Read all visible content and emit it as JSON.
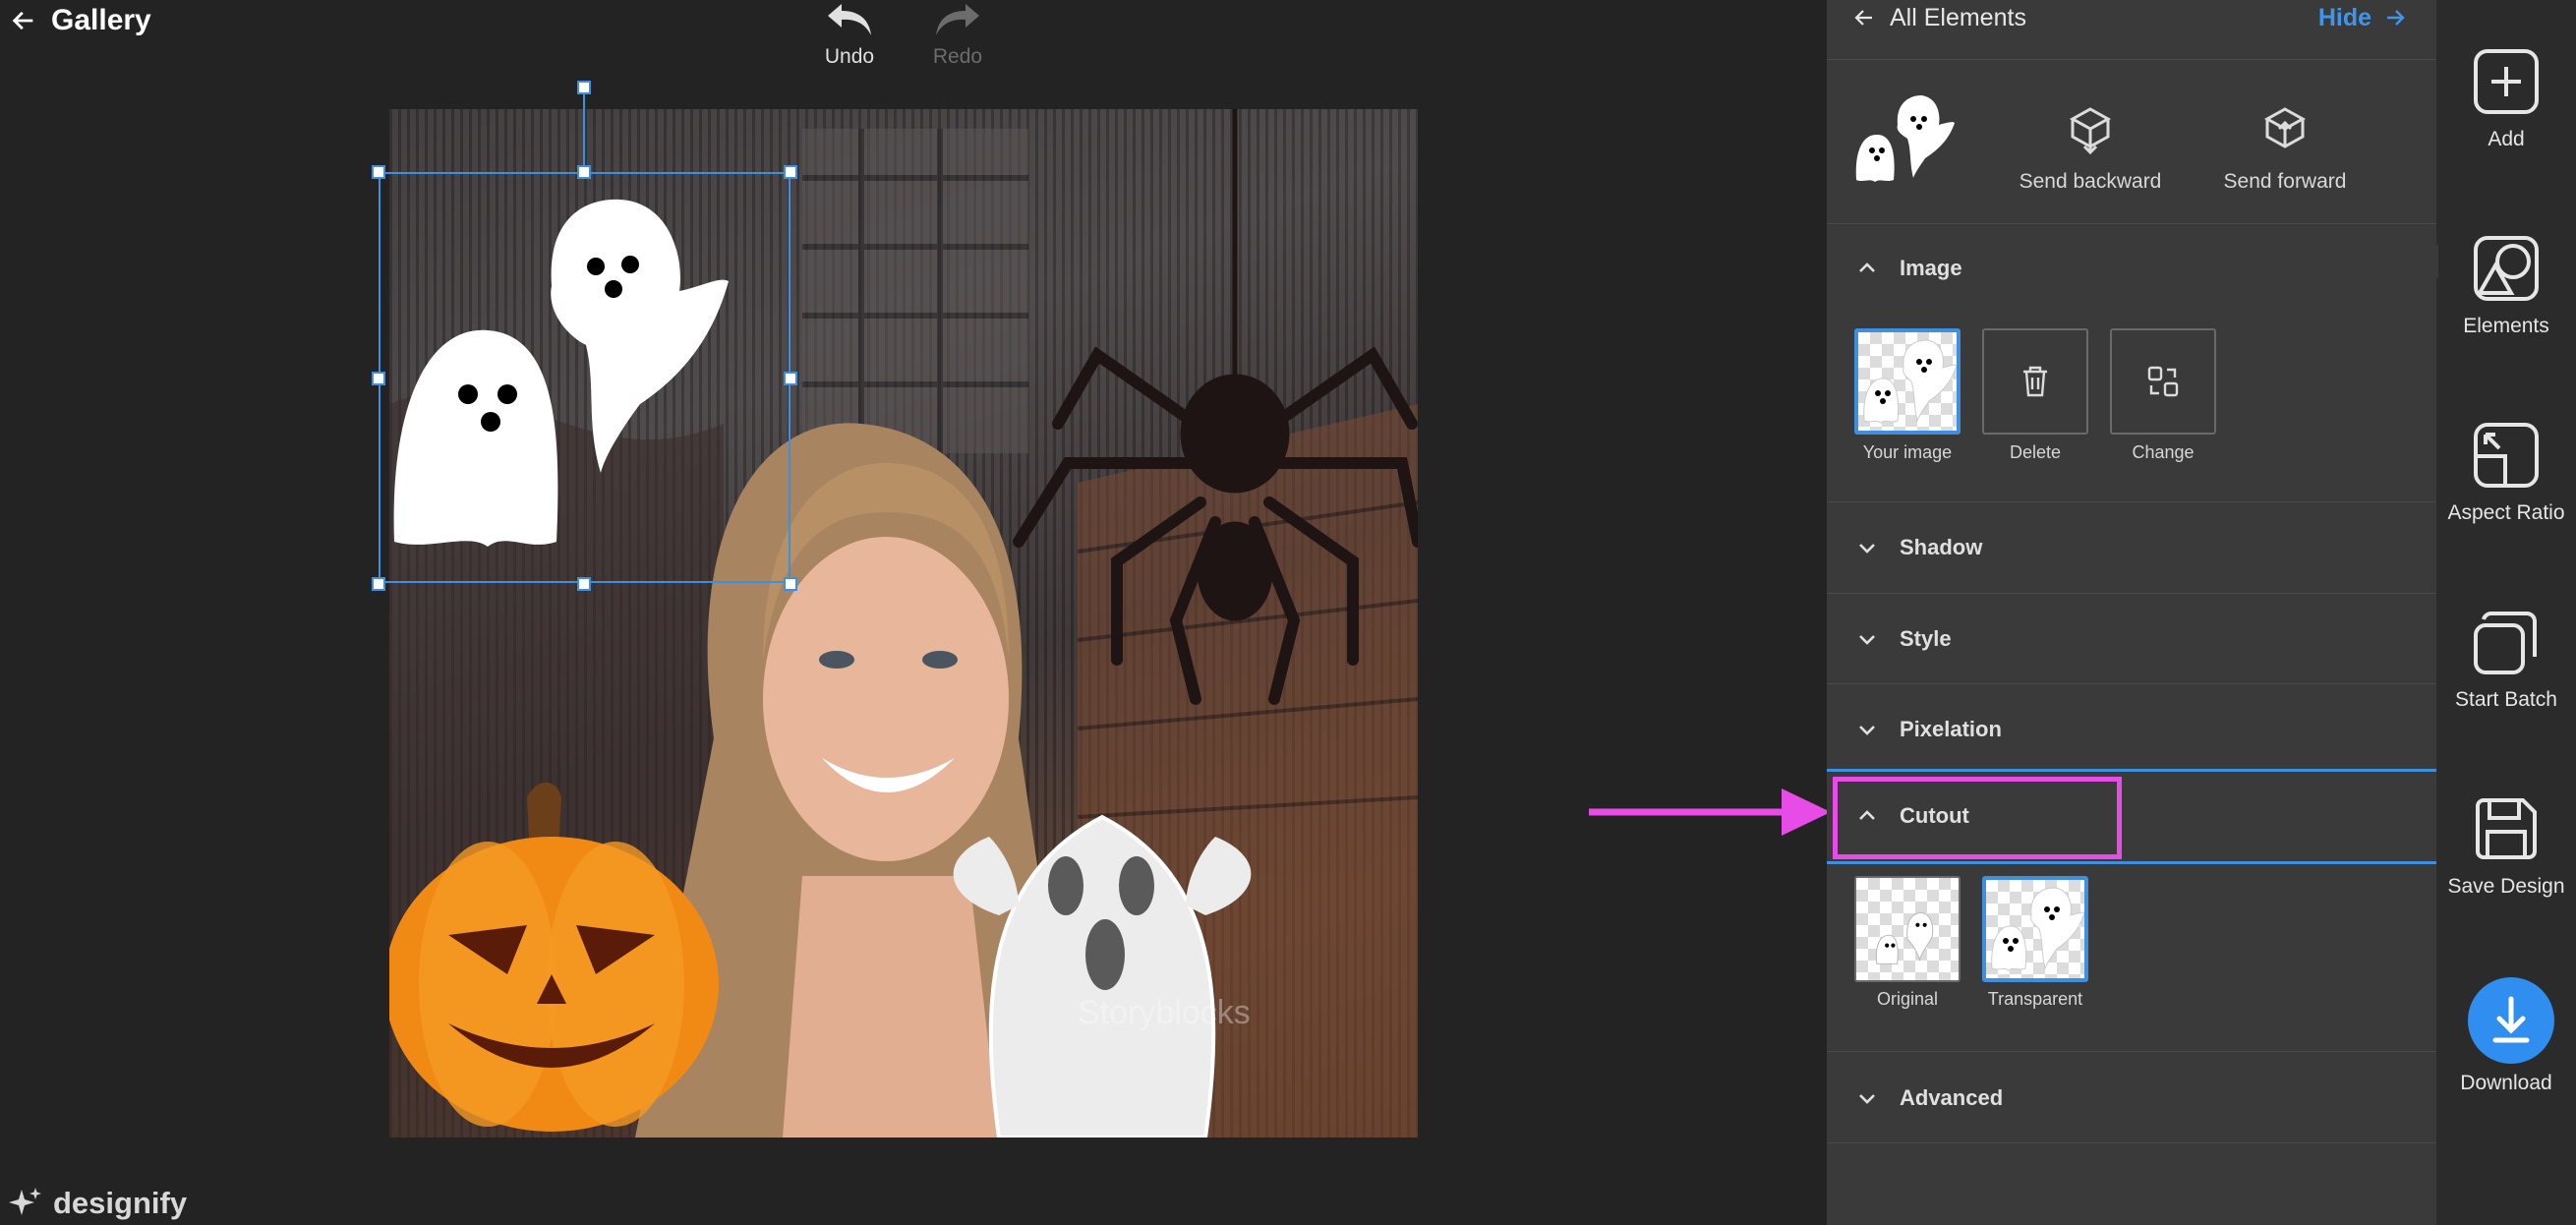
{
  "header": {
    "back_label": "Gallery",
    "undo_label": "Undo",
    "redo_label": "Redo"
  },
  "canvas": {
    "watermark": "Storyblocks"
  },
  "brand": {
    "logo_text": "designify"
  },
  "panel": {
    "title": "All Elements",
    "hide_label": "Hide",
    "layer": {
      "send_backward_label": "Send backward",
      "send_forward_label": "Send forward"
    },
    "image_section": {
      "title": "Image",
      "your_image_label": "Your image",
      "delete_label": "Delete",
      "change_label": "Change"
    },
    "shadow_title": "Shadow",
    "style_title": "Style",
    "pixelation_title": "Pixelation",
    "cutout_section": {
      "title": "Cutout",
      "original_label": "Original",
      "transparent_label": "Transparent",
      "selected": "Transparent"
    },
    "advanced_title": "Advanced"
  },
  "toolbar": {
    "add_label": "Add",
    "elements_label": "Elements",
    "aspect_ratio_label": "Aspect Ratio",
    "start_batch_label": "Start Batch",
    "save_design_label": "Save Design",
    "download_label": "Download"
  },
  "colors": {
    "accent": "#3f8fe0",
    "annotation": "#e84ce6",
    "panel_bg": "#3a3a3a",
    "app_bg": "#232323"
  }
}
